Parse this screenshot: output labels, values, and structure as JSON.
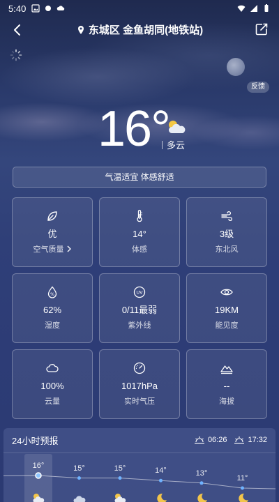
{
  "status_bar": {
    "time": "5:40"
  },
  "header": {
    "location": "东城区 金鱼胡同(地铁站)"
  },
  "feedback_label": "反馈",
  "current": {
    "temperature": "16°",
    "condition": "多云"
  },
  "comfort_text": "气温适宜 体感舒适",
  "cards": [
    {
      "icon": "leaf-icon",
      "value": "优",
      "label": "空气质量",
      "has_chevron": true
    },
    {
      "icon": "thermometer-icon",
      "value": "14°",
      "label": "体感"
    },
    {
      "icon": "wind-icon",
      "value": "3级",
      "label": "东北风"
    },
    {
      "icon": "humidity-icon",
      "value": "62%",
      "label": "湿度"
    },
    {
      "icon": "uv-icon",
      "value": "0/11最弱",
      "label": "紫外线"
    },
    {
      "icon": "eye-icon",
      "value": "19KM",
      "label": "能见度"
    },
    {
      "icon": "cloud-icon",
      "value": "100%",
      "label": "云量"
    },
    {
      "icon": "gauge-icon",
      "value": "1017hPa",
      "label": "实时气压"
    },
    {
      "icon": "mountain-icon",
      "value": "--",
      "label": "海拔"
    }
  ],
  "forecast": {
    "title": "24小时预报",
    "sunrise": "06:26",
    "sunset": "17:32",
    "hours": [
      {
        "temp": "16°",
        "icon": "partly-cloudy-icon"
      },
      {
        "temp": "15°",
        "icon": "cloudy-icon"
      },
      {
        "temp": "15°",
        "icon": "partly-cloudy-icon"
      },
      {
        "temp": "14°",
        "icon": "moon-icon"
      },
      {
        "temp": "13°",
        "icon": "moon-icon"
      },
      {
        "temp": "11°",
        "icon": "moon-icon"
      }
    ],
    "temps_numeric": [
      16,
      15,
      15,
      14,
      13,
      11
    ]
  }
}
